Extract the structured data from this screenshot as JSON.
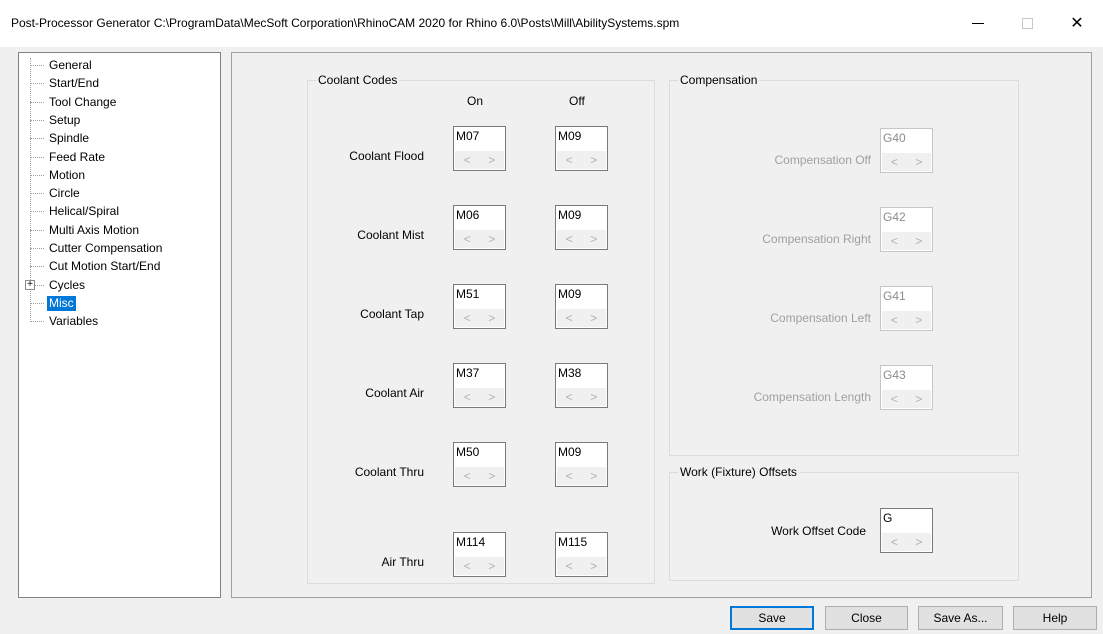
{
  "window": {
    "title": "Post-Processor Generator  C:\\ProgramData\\MecSoft Corporation\\RhinoCAM 2020 for Rhino 6.0\\Posts\\Mill\\AbilitySystems.spm",
    "minimize_icon": "minimize-icon",
    "maximize_icon": "maximize-icon",
    "close_icon": "close-icon",
    "close_glyph": "✕"
  },
  "tree": {
    "items": [
      {
        "label": "General"
      },
      {
        "label": "Start/End"
      },
      {
        "label": "Tool Change"
      },
      {
        "label": "Setup"
      },
      {
        "label": "Spindle"
      },
      {
        "label": "Feed Rate"
      },
      {
        "label": "Motion"
      },
      {
        "label": "Circle"
      },
      {
        "label": "Helical/Spiral"
      },
      {
        "label": "Multi Axis Motion"
      },
      {
        "label": "Cutter Compensation"
      },
      {
        "label": "Cut Motion Start/End"
      },
      {
        "label": "Cycles",
        "expander": "+"
      },
      {
        "label": "Misc",
        "selected": true
      },
      {
        "label": "Variables"
      }
    ]
  },
  "coolant": {
    "title": "Coolant Codes",
    "on_header": "On",
    "off_header": "Off",
    "rows": [
      {
        "label": "Coolant Flood",
        "on": "M07",
        "off": "M09"
      },
      {
        "label": "Coolant Mist",
        "on": "M06",
        "off": "M09"
      },
      {
        "label": "Coolant Tap",
        "on": "M51",
        "off": "M09"
      },
      {
        "label": "Coolant Air",
        "on": "M37",
        "off": "M38"
      },
      {
        "label": "Coolant Thru",
        "on": "M50",
        "off": "M09"
      },
      {
        "label": "Air Thru",
        "on": "M114",
        "off": "M115"
      }
    ]
  },
  "compensation": {
    "title": "Compensation",
    "rows": [
      {
        "label": "Compensation Off",
        "value": "G40"
      },
      {
        "label": "Compensation Right",
        "value": "G42"
      },
      {
        "label": "Compensation Left",
        "value": "G41"
      },
      {
        "label": "Compensation Length",
        "value": "G43"
      }
    ]
  },
  "work_offsets": {
    "title": "Work (Fixture) Offsets",
    "label": "Work Offset Code",
    "value": "G"
  },
  "spinner": {
    "left_arrow": "<",
    "right_arrow": ">"
  },
  "buttons": {
    "save": "Save",
    "close": "Close",
    "save_as": "Save As...",
    "help": "Help"
  },
  "colors": {
    "accent": "#0078d7",
    "disabled_text": "#a0a0a0"
  }
}
